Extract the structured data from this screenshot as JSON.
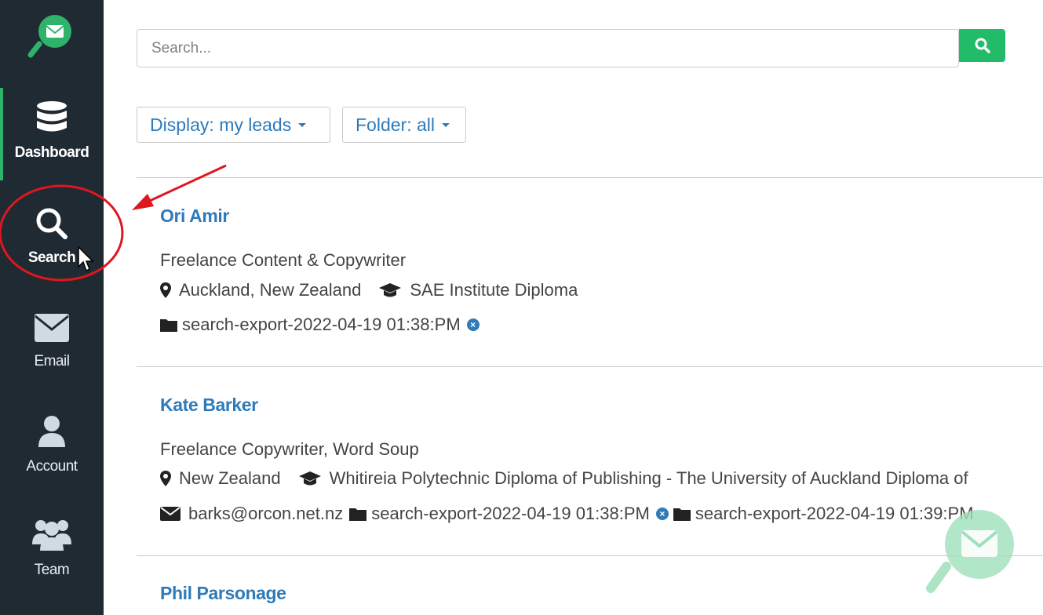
{
  "sidebar": {
    "items": [
      {
        "label": "Dashboard",
        "icon": "database-icon"
      },
      {
        "label": "Search",
        "icon": "search-icon"
      },
      {
        "label": "Email",
        "icon": "envelope-icon"
      },
      {
        "label": "Account",
        "icon": "user-icon"
      },
      {
        "label": "Team",
        "icon": "team-icon"
      }
    ]
  },
  "search": {
    "placeholder": "Search..."
  },
  "filters": {
    "display_label": "Display: my leads",
    "folder_label": "Folder: all"
  },
  "leads": [
    {
      "name": "Ori Amir",
      "title": "Freelance Content & Copywriter",
      "location": "Auckland, New Zealand",
      "education": "SAE Institute Diploma",
      "folders": [
        "search-export-2022-04-19 01:38:PM"
      ]
    },
    {
      "name": "Kate Barker",
      "title": "Freelance Copywriter, Word Soup",
      "location": "New Zealand",
      "education": "Whitireia Polytechnic Diploma of Publishing - The University of Auckland Diploma of",
      "email": "barks@orcon.net.nz",
      "folders": [
        "search-export-2022-04-19 01:38:PM",
        "search-export-2022-04-19 01:39:PM"
      ]
    },
    {
      "name": "Phil Parsonage"
    }
  ],
  "colors": {
    "accent": "#22bb6a",
    "link": "#2f7ab8",
    "sidebar": "#202a33",
    "annotation": "#e0161f"
  }
}
